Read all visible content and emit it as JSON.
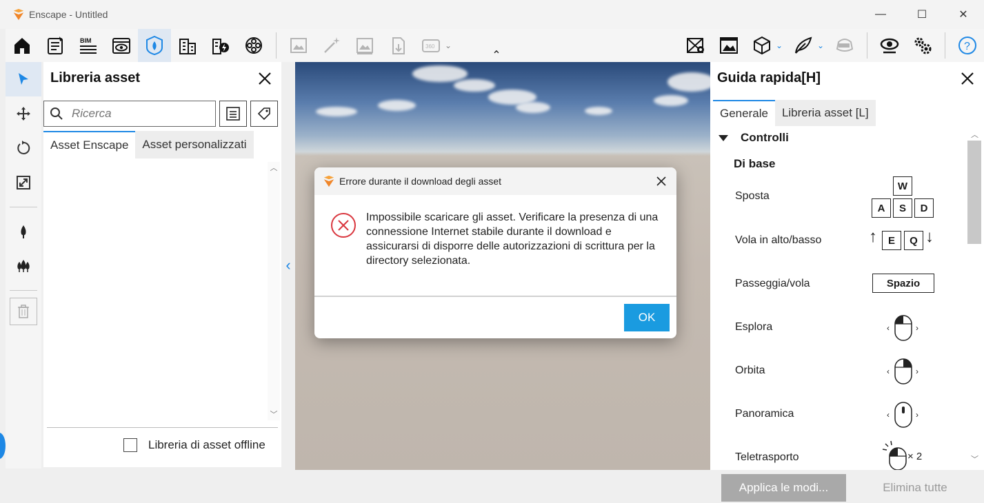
{
  "window": {
    "title": "Enscape - Untitled",
    "minimize_glyph": "—",
    "maximize_glyph": "☐",
    "close_glyph": "✕"
  },
  "toolbar": {
    "items": [
      {
        "name": "home-icon",
        "state": "normal"
      },
      {
        "name": "project-notes-icon",
        "state": "normal"
      },
      {
        "name": "bim-icon",
        "state": "normal",
        "label": "BIM"
      },
      {
        "name": "view-icon",
        "state": "normal"
      },
      {
        "name": "asset-library-icon",
        "state": "active"
      },
      {
        "name": "building-icon",
        "state": "normal"
      },
      {
        "name": "energy-icon",
        "state": "normal"
      },
      {
        "name": "material-icon",
        "state": "normal"
      }
    ],
    "disabled_items": [
      "screenshot-icon",
      "ai-enhance-icon",
      "batch-render-icon",
      "export-icon",
      "panorama-360-icon"
    ],
    "panorama_label": "360",
    "right_items": [
      "map-pin-icon",
      "image-icon",
      "cube-icon",
      "feather-icon",
      "vr-headset-icon",
      "visual-settings-icon",
      "settings-icon",
      "help-icon"
    ],
    "collapse_caret": "⌃"
  },
  "asset_panel": {
    "title": "Libreria asset",
    "search_placeholder": "Ricerca",
    "tabs": [
      "Asset Enscape",
      "Asset personalizzati"
    ],
    "offline_label": "Libreria di asset offline",
    "offline_checked": false
  },
  "dialog": {
    "title": "Errore durante il download degli asset",
    "message": "Impossibile scaricare gli asset. Verificare la presenza di una connessione Internet stabile durante il download e assicurarsi di disporre delle autorizzazioni di scrittura per la directory selezionata.",
    "ok_label": "OK",
    "accent": "#1a9be0",
    "error_color": "#d9363e"
  },
  "guide": {
    "title": "Guida rapida[H]",
    "tabs": [
      "Generale",
      "Libreria asset [L]"
    ],
    "section": "Controlli",
    "subsection": "Di base",
    "rows": [
      {
        "label": "Sposta",
        "keys": [
          "W",
          "A",
          "S",
          "D"
        ]
      },
      {
        "label": "Vola in alto/basso",
        "keys": [
          "E",
          "Q"
        ]
      },
      {
        "label": "Passeggia/vola",
        "keys": [
          "Spazio"
        ]
      },
      {
        "label": "Esplora",
        "mouse": "left-button"
      },
      {
        "label": "Orbita",
        "mouse": "right-button"
      },
      {
        "label": "Panoramica",
        "mouse": "middle-button"
      },
      {
        "label": "Teletrasporto",
        "mouse": "left-double-click",
        "suffix": "× 2"
      }
    ],
    "side_glyphs": {
      "left": "‹",
      "right": "›",
      "up": "↑",
      "down": "↓"
    }
  },
  "bottom": {
    "apply_label": "Applica le modi...",
    "delete_label": "Elimina tutte"
  },
  "colors": {
    "accent": "#1e88e5",
    "logo": "#f0862a"
  }
}
